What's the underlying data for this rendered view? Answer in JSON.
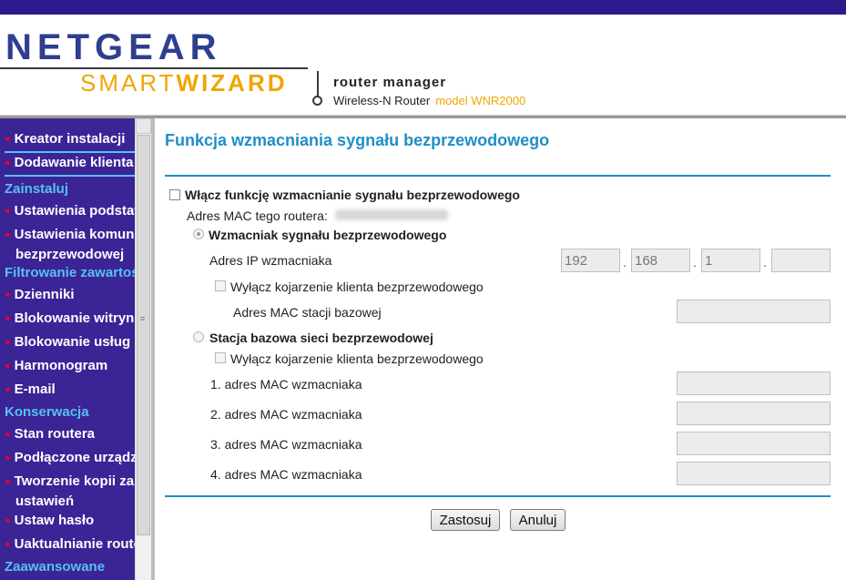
{
  "header": {
    "brand": "NETGEAR",
    "product_smart": "SMART",
    "product_wizard": "WIZARD",
    "router_manager": "router manager",
    "router_type": "Wireless-N Router",
    "model": "model WNR2000"
  },
  "sidebar": {
    "items": [
      {
        "label": "Kreator instalacji",
        "type": "item"
      },
      {
        "label": "Dodawanie klienta",
        "type": "item"
      },
      {
        "label": "Zainstaluj",
        "type": "section"
      },
      {
        "label": "Ustawienia podstawowe",
        "type": "item"
      },
      {
        "label": "Ustawienia komunikacji",
        "line2": "bezprzewodowej",
        "type": "item"
      },
      {
        "label": "Filtrowanie zawartości",
        "type": "section"
      },
      {
        "label": "Dzienniki",
        "type": "item"
      },
      {
        "label": "Blokowanie witryn",
        "type": "item"
      },
      {
        "label": "Blokowanie usług",
        "type": "item"
      },
      {
        "label": "Harmonogram",
        "type": "item"
      },
      {
        "label": "E-mail",
        "type": "item"
      },
      {
        "label": "Konserwacja",
        "type": "section"
      },
      {
        "label": "Stan routera",
        "type": "item"
      },
      {
        "label": "Podłączone urządzenia",
        "type": "item"
      },
      {
        "label": "Tworzenie kopii zapasowej",
        "line2": "ustawień",
        "type": "item"
      },
      {
        "label": "Ustaw hasło",
        "type": "item"
      },
      {
        "label": "Uaktualnianie routera",
        "type": "item"
      },
      {
        "label": "Zaawansowane",
        "type": "section"
      }
    ]
  },
  "main": {
    "title": "Funkcja wzmacniania sygnału bezprzewodowego",
    "enable_label": "Włącz funkcję wzmacnianie sygnału bezprzewodowego",
    "mac_label": "Adres MAC tego routera:",
    "repeater_label": "Wzmacniak sygnału bezprzewodowego",
    "repeater_ip_label": "Adres IP wzmacniaka",
    "ip": [
      "192",
      "168",
      "1",
      ""
    ],
    "ip_separator": ".",
    "disable_assoc_label": "Wyłącz kojarzenie klienta bezprzewodowego",
    "base_mac_label": "Adres MAC stacji bazowej",
    "base_station_label": "Stacja bazowa sieci bezprzewodowej",
    "repeater_mac_labels": [
      "1. adres MAC wzmacniaka",
      "2. adres MAC wzmacniaka",
      "3. adres MAC wzmacniaka",
      "4. adres MAC wzmacniaka"
    ],
    "apply_label": "Zastosuj",
    "cancel_label": "Anuluj"
  },
  "colors": {
    "sidebar_bg": "#3b2496",
    "section_text": "#56c2f0",
    "bullet": "#e0003c",
    "title_blue": "#1e8fc8",
    "brand_blue": "#2e3f8f",
    "brand_orange": "#f0a500"
  }
}
